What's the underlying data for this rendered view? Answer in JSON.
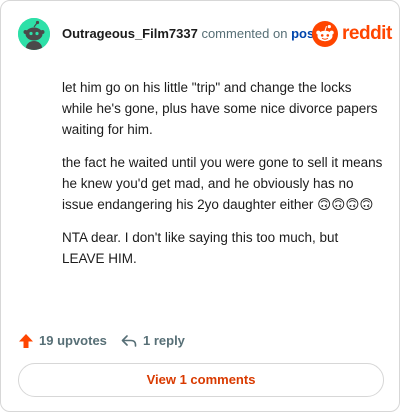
{
  "header": {
    "username": "Outrageous_Film7337",
    "action_text": "commented on",
    "post_link": "post",
    "brand": "reddit"
  },
  "comment": {
    "paragraphs": [
      "let him go on his little \"trip\" and change the locks while he's gone, plus have some nice divorce papers waiting for him.",
      "the fact he waited until you were gone to sell it means he knew you'd get mad, and he obviously has no issue endangering his 2yo daughter either 🙃🙃🙃🙃",
      "NTA dear. I don't like saying this too much, but LEAVE HIM."
    ]
  },
  "actions": {
    "upvotes": "19 upvotes",
    "replies": "1 reply"
  },
  "footer": {
    "view_button": "View 1 comments"
  },
  "colors": {
    "brand_orange": "#ff4500",
    "upvote_arrow": "#ff4500",
    "avatar_bg": "#2ee0a8",
    "link_blue": "#0045ac",
    "view_button_text": "#d93a00",
    "muted_text": "#576f76"
  },
  "icons": {
    "avatar": "snoo-avatar-icon",
    "logo": "reddit-snoo-icon",
    "upvote": "upvote-arrow-icon",
    "reply": "reply-arrow-icon"
  }
}
